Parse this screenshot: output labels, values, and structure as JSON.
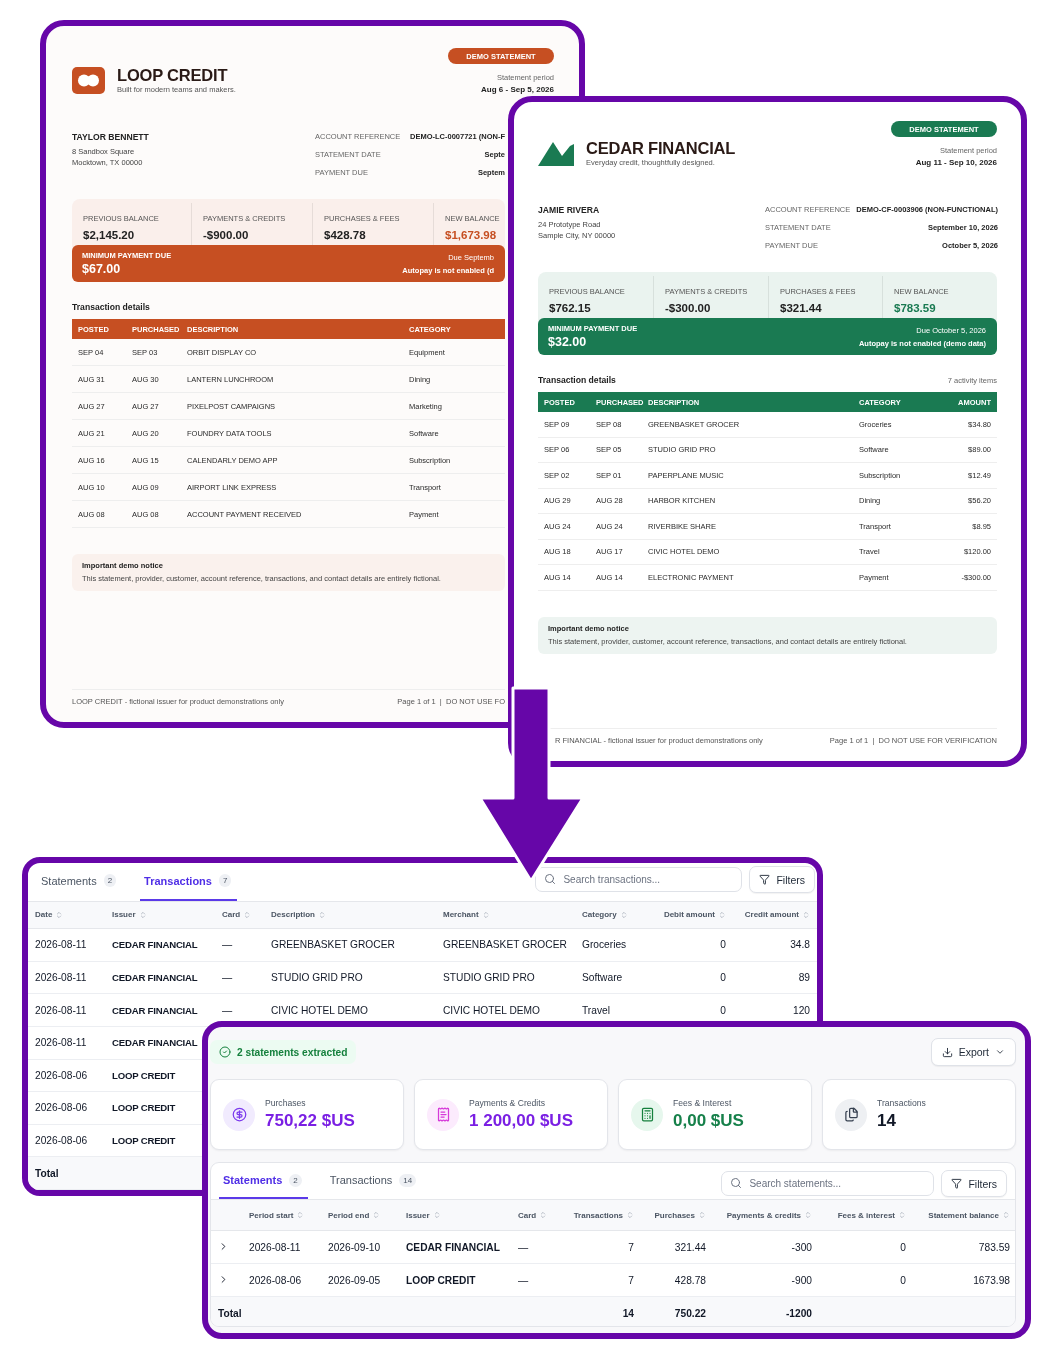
{
  "statements": [
    {
      "kind": "rings",
      "color": "#c64f22",
      "badge": "DEMO STATEMENT",
      "brand": "LOOP CREDIT",
      "tagline": "Built for modern teams and makers.",
      "period_label": "Statement period",
      "period": "Aug 6 - Sep 5, 2026",
      "customer": {
        "name": "TAYLOR BENNETT",
        "address": [
          "8 Sandbox Square",
          "Mocktown, TX 00000"
        ]
      },
      "meta": [
        {
          "label": "ACCOUNT REFERENCE",
          "value": "DEMO-LC-0007721 (NON-F"
        },
        {
          "label": "STATEMENT DATE",
          "value": "Septe"
        },
        {
          "label": "PAYMENT DUE",
          "value": "Septem"
        }
      ],
      "summary": [
        {
          "label": "PREVIOUS BALANCE",
          "value": "$2,145.20",
          "highlight": false
        },
        {
          "label": "PAYMENTS & CREDITS",
          "value": "-$900.00",
          "highlight": false
        },
        {
          "label": "PURCHASES & FEES",
          "value": "$428.78",
          "highlight": false
        },
        {
          "label": "NEW BALANCE",
          "value": "$1,673.98",
          "highlight": true
        }
      ],
      "minimum": {
        "label": "MINIMUM PAYMENT DUE",
        "amount": "$67.00",
        "due": "Due Septemb",
        "autopay": "Autopay is not enabled (d"
      },
      "section_title": "Transaction details",
      "columns": [
        "POSTED",
        "PURCHASED",
        "DESCRIPTION",
        "CATEGORY"
      ],
      "rows": [
        [
          "SEP 04",
          "SEP 03",
          "ORBIT DISPLAY CO",
          "Equipment"
        ],
        [
          "AUG 31",
          "AUG 30",
          "LANTERN LUNCHROOM",
          "Dining"
        ],
        [
          "AUG 27",
          "AUG 27",
          "PIXELPOST CAMPAIGNS",
          "Marketing"
        ],
        [
          "AUG 21",
          "AUG 20",
          "FOUNDRY DATA TOOLS",
          "Software"
        ],
        [
          "AUG 16",
          "AUG 15",
          "CALENDARLY DEMO APP",
          "Subscription"
        ],
        [
          "AUG 10",
          "AUG 09",
          "AIRPORT LINK EXPRESS",
          "Transport"
        ],
        [
          "AUG 08",
          "AUG 08",
          "ACCOUNT PAYMENT RECEIVED",
          "Payment"
        ]
      ],
      "notice": {
        "title": "Important demo notice",
        "text": "This statement, provider, customer, account reference, transactions, and contact details are entirely fictional."
      },
      "footer": {
        "left": "LOOP CREDIT - fictional issuer for product demonstrations only",
        "right": "Page 1 of 1  |  DO NOT USE FO"
      }
    },
    {
      "kind": "peak",
      "color": "#1a7a52",
      "badge": "DEMO STATEMENT",
      "brand": "CEDAR FINANCIAL",
      "tagline": "Everyday credit, thoughtfully designed.",
      "period_label": "Statement period",
      "period": "Aug 11 - Sep 10, 2026",
      "customer": {
        "name": "JAMIE RIVERA",
        "address": [
          "24 Prototype Road",
          "Sample City, NY 00000"
        ]
      },
      "meta": [
        {
          "label": "ACCOUNT REFERENCE",
          "value": "DEMO-CF-0003906 (NON-FUNCTIONAL)"
        },
        {
          "label": "STATEMENT DATE",
          "value": "September 10, 2026"
        },
        {
          "label": "PAYMENT DUE",
          "value": "October 5, 2026"
        }
      ],
      "summary": [
        {
          "label": "PREVIOUS BALANCE",
          "value": "$762.15",
          "highlight": false
        },
        {
          "label": "PAYMENTS & CREDITS",
          "value": "-$300.00",
          "highlight": false
        },
        {
          "label": "PURCHASES & FEES",
          "value": "$321.44",
          "highlight": false
        },
        {
          "label": "NEW BALANCE",
          "value": "$783.59",
          "highlight": true
        }
      ],
      "minimum": {
        "label": "MINIMUM PAYMENT DUE",
        "amount": "$32.00",
        "due": "Due October 5, 2026",
        "autopay": "Autopay is not enabled (demo data)"
      },
      "section_title": "Transaction details",
      "item_count": "7 activity items",
      "columns": [
        "POSTED",
        "PURCHASED",
        "DESCRIPTION",
        "CATEGORY",
        "AMOUNT"
      ],
      "rows": [
        [
          "SEP 09",
          "SEP 08",
          "GREENBASKET GROCER",
          "Groceries",
          "$34.80"
        ],
        [
          "SEP 06",
          "SEP 05",
          "STUDIO GRID PRO",
          "Software",
          "$89.00"
        ],
        [
          "SEP 02",
          "SEP 01",
          "PAPERPLANE MUSIC",
          "Subscription",
          "$12.49"
        ],
        [
          "AUG 29",
          "AUG 28",
          "HARBOR KITCHEN",
          "Dining",
          "$56.20"
        ],
        [
          "AUG 24",
          "AUG 24",
          "RIVERBIKE SHARE",
          "Transport",
          "$8.95"
        ],
        [
          "AUG 18",
          "AUG 17",
          "CIVIC HOTEL DEMO",
          "Travel",
          "$120.00"
        ],
        [
          "AUG 14",
          "AUG 14",
          "ELECTRONIC PAYMENT",
          "Payment",
          "-$300.00"
        ]
      ],
      "notice": {
        "title": "Important demo notice",
        "text": "This statement, provider, customer, account reference, transactions, and contact details are entirely fictional."
      },
      "footer": {
        "left": "R FINANCIAL - fictional issuer for product demonstrations only",
        "right": "Page 1 of 1  |  DO NOT USE FOR VERIFICATION"
      }
    }
  ],
  "transactions_panel": {
    "tabs": [
      {
        "label": "Statements",
        "count": "2",
        "selected": false
      },
      {
        "label": "Transactions",
        "count": "7",
        "selected": true
      }
    ],
    "search": {
      "placeholder": "Search transactions..."
    },
    "filters_button": "Filters",
    "columns": [
      "Date",
      "Issuer",
      "Card",
      "Description",
      "Merchant",
      "Category",
      "Debit amount",
      "Credit amount"
    ],
    "rows": [
      [
        "2026-08-11",
        "CEDAR FINANCIAL",
        "—",
        "GREENBASKET GROCER",
        "GREENBASKET GROCER",
        "Groceries",
        "0",
        "34.8"
      ],
      [
        "2026-08-11",
        "CEDAR FINANCIAL",
        "—",
        "STUDIO GRID PRO",
        "STUDIO GRID PRO",
        "Software",
        "0",
        "89"
      ],
      [
        "2026-08-11",
        "CEDAR FINANCIAL",
        "—",
        "CIVIC HOTEL DEMO",
        "CIVIC HOTEL DEMO",
        "Travel",
        "0",
        "120"
      ],
      [
        "2026-08-11",
        "CEDAR FINANCIAL"
      ],
      [
        "2026-08-06",
        "LOOP CREDIT"
      ],
      [
        "2026-08-06",
        "LOOP CREDIT"
      ],
      [
        "2026-08-06",
        "LOOP CREDIT"
      ]
    ],
    "total_label": "Total"
  },
  "summary_panel": {
    "status": "2 statements extracted",
    "export_button": "Export",
    "stats": [
      {
        "kind": "purchases",
        "label": "Purchases",
        "value": "750,22 $US",
        "color": "#7a1fe3"
      },
      {
        "kind": "payments",
        "label": "Payments & Credits",
        "value": "1 200,00 $US",
        "color": "#7a1fe3"
      },
      {
        "kind": "fees",
        "label": "Fees & Interest",
        "value": "0,00 $US",
        "color": "#16804a"
      },
      {
        "kind": "count",
        "label": "Transactions",
        "value": "14",
        "color": "#111827"
      }
    ],
    "tabs": [
      {
        "label": "Statements",
        "count": "2",
        "selected": true
      },
      {
        "label": "Transactions",
        "count": "14",
        "selected": false
      }
    ],
    "search": {
      "placeholder": "Search statements..."
    },
    "filters_button": "Filters",
    "columns": [
      "Period start",
      "Period end",
      "Issuer",
      "Card",
      "Transactions",
      "Purchases",
      "Payments & credits",
      "Fees & interest",
      "Statement balance"
    ],
    "rows": [
      {
        "expanded": false,
        "cells": [
          "2026-08-11",
          "2026-09-10",
          "CEDAR FINANCIAL",
          "—",
          "7",
          "321.44",
          "-300",
          "0",
          "783.59"
        ]
      },
      {
        "expanded": false,
        "cells": [
          "2026-08-06",
          "2026-09-05",
          "LOOP CREDIT",
          "—",
          "7",
          "428.78",
          "-900",
          "0",
          "1673.98"
        ]
      }
    ],
    "total": {
      "label": "Total",
      "transactions": "14",
      "purchases": "750.22",
      "payments": "-1200"
    }
  }
}
